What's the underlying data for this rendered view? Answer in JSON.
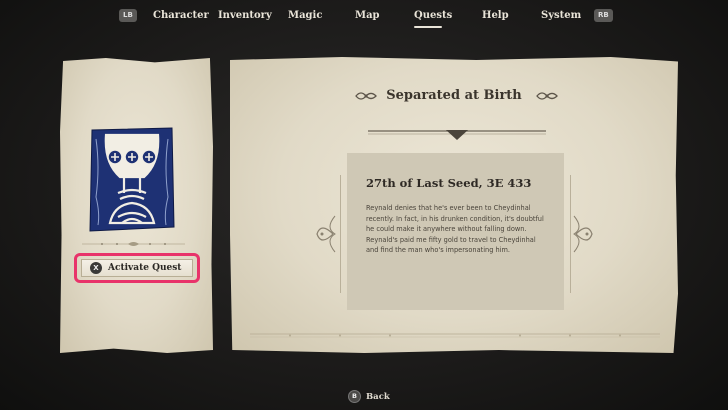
{
  "nav": {
    "lb": "LB",
    "rb": "RB",
    "tabs": [
      {
        "label": "Character"
      },
      {
        "label": "Inventory"
      },
      {
        "label": "Magic"
      },
      {
        "label": "Map"
      },
      {
        "label": "Quests",
        "active": true
      },
      {
        "label": "Help"
      },
      {
        "label": "System"
      }
    ]
  },
  "quest": {
    "title": "Separated at Birth",
    "icon": "chalice-skull-icon",
    "activate_button_glyph": "X",
    "activate_label": "Activate Quest",
    "entry_date": "27th of Last Seed, 3E 433",
    "entry_text": "Reynald denies that he's ever been to Cheydinhal recently. In fact, in his drunken condition, it's doubtful he could make it anywhere without falling down. Reynald's paid me fifty gold to travel to Cheydinhal and find the man who's impersonating him."
  },
  "footer": {
    "back_glyph": "B",
    "back_label": "Back"
  },
  "colors": {
    "highlight": "#e8336a",
    "parchment": "#e1dac7",
    "icon_blue": "#1e3174"
  }
}
